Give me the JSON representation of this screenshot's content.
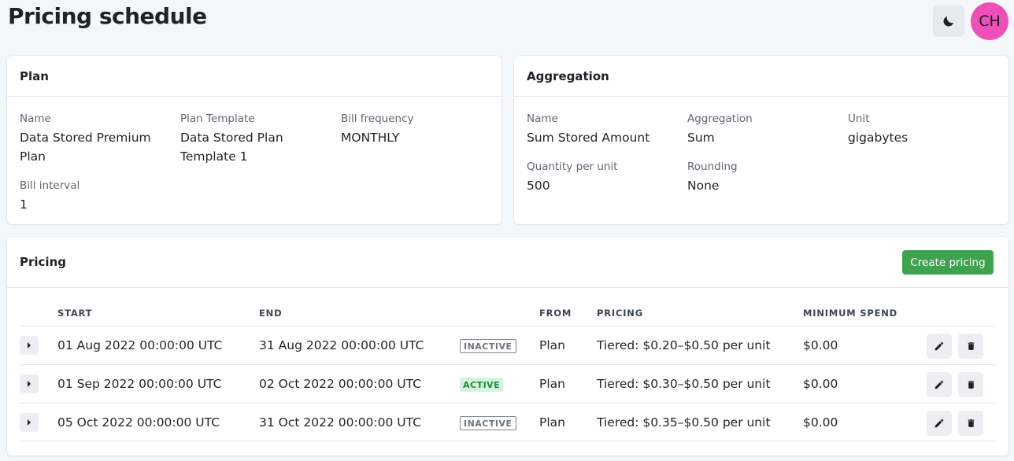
{
  "page": {
    "title": "Pricing schedule"
  },
  "header": {
    "avatar_initials": "CH",
    "theme_icon": "moon-icon"
  },
  "plan": {
    "title": "Plan",
    "name_label": "Name",
    "name_value": "Data Stored Premium Plan",
    "template_label": "Plan Template",
    "template_value": "Data Stored Plan Template 1",
    "frequency_label": "Bill frequency",
    "frequency_value": "MONTHLY",
    "interval_label": "Bill interval",
    "interval_value": "1"
  },
  "aggregation": {
    "title": "Aggregation",
    "name_label": "Name",
    "name_value": "Sum Stored Amount",
    "aggregation_label": "Aggregation",
    "aggregation_value": "Sum",
    "unit_label": "Unit",
    "unit_value": "gigabytes",
    "qty_label": "Quantity per unit",
    "qty_value": "500",
    "rounding_label": "Rounding",
    "rounding_value": "None"
  },
  "pricing": {
    "title": "Pricing",
    "create_label": "Create pricing",
    "columns": {
      "start": "START",
      "end": "END",
      "from": "FROM",
      "pricing": "PRICING",
      "min_spend": "MINIMUM SPEND"
    },
    "rows": [
      {
        "start": "01 Aug 2022 00:00:00 UTC",
        "end": "31 Aug 2022 00:00:00 UTC",
        "status": "INACTIVE",
        "from": "Plan",
        "pricing": "Tiered: $0.20–$0.50 per unit",
        "min_spend": "$0.00"
      },
      {
        "start": "01 Sep 2022 00:00:00 UTC",
        "end": "02 Oct 2022 00:00:00 UTC",
        "status": "ACTIVE",
        "from": "Plan",
        "pricing": "Tiered: $0.30–$0.50 per unit",
        "min_spend": "$0.00"
      },
      {
        "start": "05 Oct 2022 00:00:00 UTC",
        "end": "31 Oct 2022 00:00:00 UTC",
        "status": "INACTIVE",
        "from": "Plan",
        "pricing": "Tiered: $0.35–$0.50 per unit",
        "min_spend": "$0.00"
      }
    ]
  },
  "colors": {
    "accent_green": "#3fa24f",
    "avatar_pink": "#ee4fb8",
    "active_badge_bg": "#d4f3dc"
  }
}
